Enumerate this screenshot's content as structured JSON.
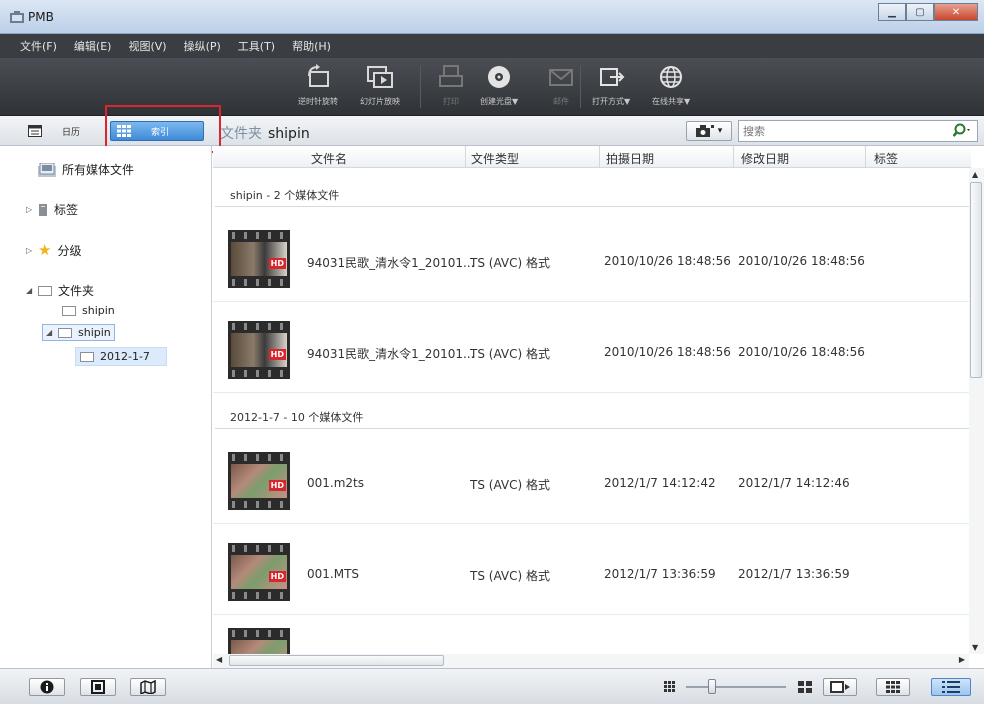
{
  "window": {
    "title": "PMB"
  },
  "menu": [
    "文件(F)",
    "编辑(E)",
    "视图(V)",
    "操纵(P)",
    "工具(T)",
    "帮助(H)"
  ],
  "toolbar": {
    "rotate_label": "逆时针旋转",
    "slideshow_label": "幻灯片放映",
    "print_label": "打印",
    "create_disc_label": "创建光盘▼",
    "email_label": "邮件",
    "open_with_label": "打开方式▼",
    "online_share_label": "在线共享▼"
  },
  "view_tabs": {
    "calendar_label": "日历",
    "index_label": "索引"
  },
  "breadcrumb": {
    "prefix": "文件夹",
    "folder": "shipin"
  },
  "search": {
    "placeholder": "搜索"
  },
  "sidebar": {
    "all_media": "所有媒体文件",
    "tags": "标签",
    "ratings": "分级",
    "folders": "文件夹",
    "folder_shipin_1": "shipin",
    "folder_shipin_2": "shipin",
    "folder_2012": "2012-1-7"
  },
  "columns": {
    "filename": "文件名",
    "filetype": "文件类型",
    "shot_date": "拍摄日期",
    "modified_date": "修改日期",
    "tags": "标签"
  },
  "groups": [
    {
      "title": "shipin  - 2 个媒体文件",
      "rows": [
        {
          "name": "94031民歌_清水令1_20101...",
          "type": "TS (AVC) 格式",
          "shot": "2010/10/26 18:48:56",
          "modified": "2010/10/26 18:48:56"
        },
        {
          "name": "94031民歌_清水令1_20101...",
          "type": "TS (AVC) 格式",
          "shot": "2010/10/26 18:48:56",
          "modified": "2010/10/26 18:48:56"
        }
      ]
    },
    {
      "title": "2012-1-7  - 10 个媒体文件",
      "rows": [
        {
          "name": "001.m2ts",
          "type": "TS (AVC) 格式",
          "shot": "2012/1/7 14:12:42",
          "modified": "2012/1/7 14:12:46"
        },
        {
          "name": "001.MTS",
          "type": "TS (AVC) 格式",
          "shot": "2012/1/7 13:36:59",
          "modified": "2012/1/7 13:36:59"
        }
      ]
    }
  ],
  "thumb_badge": "HD",
  "colors": {
    "highlight": "#d9262c",
    "selected_tab": "#3f8ad8",
    "menubar": "#3a3d42"
  }
}
